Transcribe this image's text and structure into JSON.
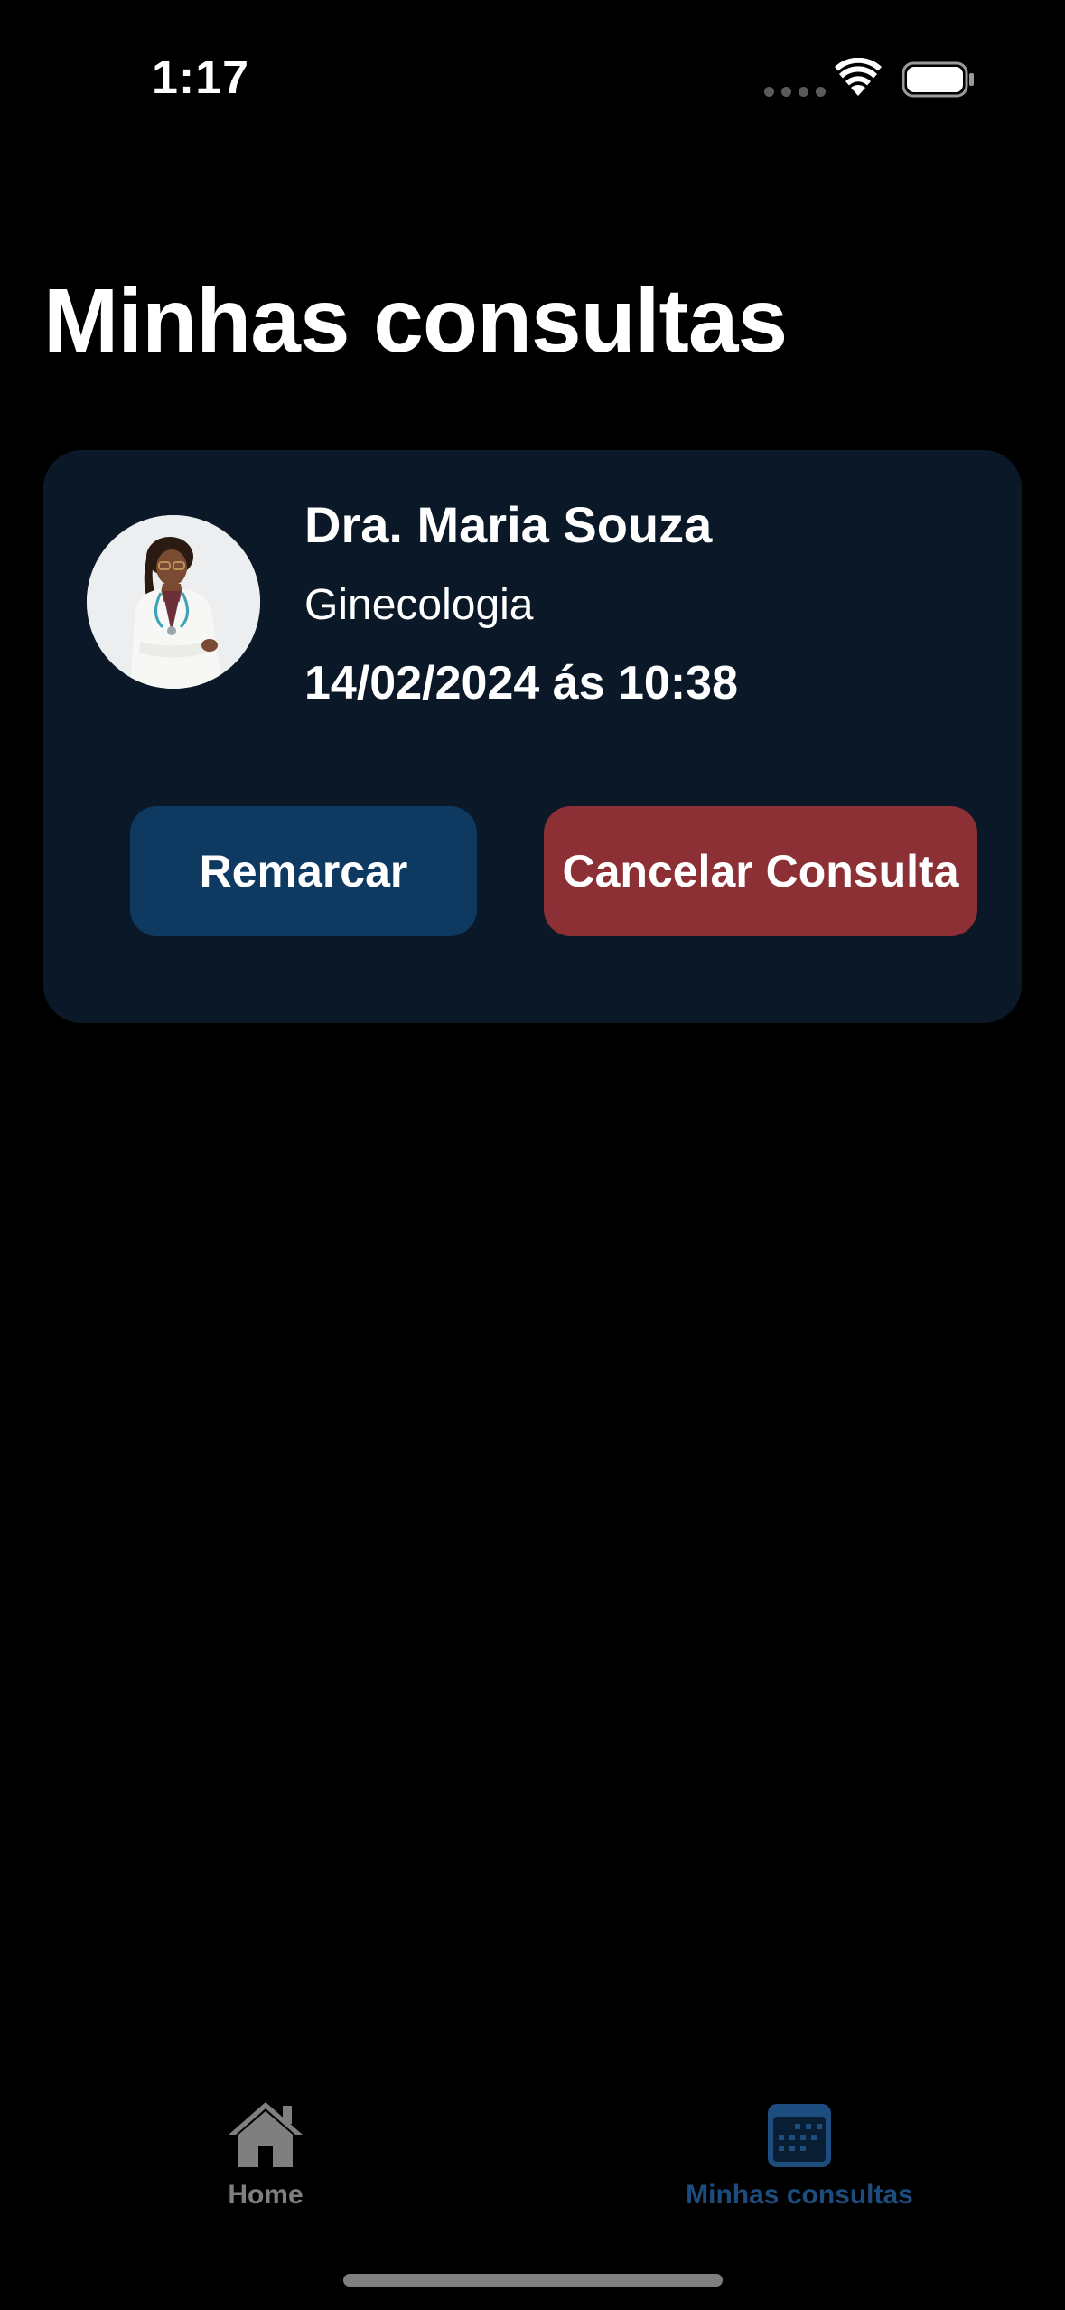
{
  "status_bar": {
    "time": "1:17"
  },
  "page": {
    "title": "Minhas consultas"
  },
  "appointment": {
    "doctor_name": "Dra. Maria Souza",
    "specialty": "Ginecologia",
    "datetime": "14/02/2024 ás 10:38",
    "avatar_icon": "doctor-photo",
    "reschedule_label": "Remarcar",
    "cancel_label": "Cancelar Consulta"
  },
  "tab_bar": {
    "tabs": [
      {
        "label": "Home",
        "icon": "house-icon",
        "active": false
      },
      {
        "label": "Minhas consultas",
        "icon": "calendar-icon",
        "active": true
      }
    ]
  },
  "colors": {
    "background": "#000000",
    "card": "#0a1827",
    "reschedule_button": "#0e3a62",
    "cancel_button": "#8c3035",
    "tab_active": "#1c4d7e",
    "tab_inactive": "#7f7f7f"
  }
}
